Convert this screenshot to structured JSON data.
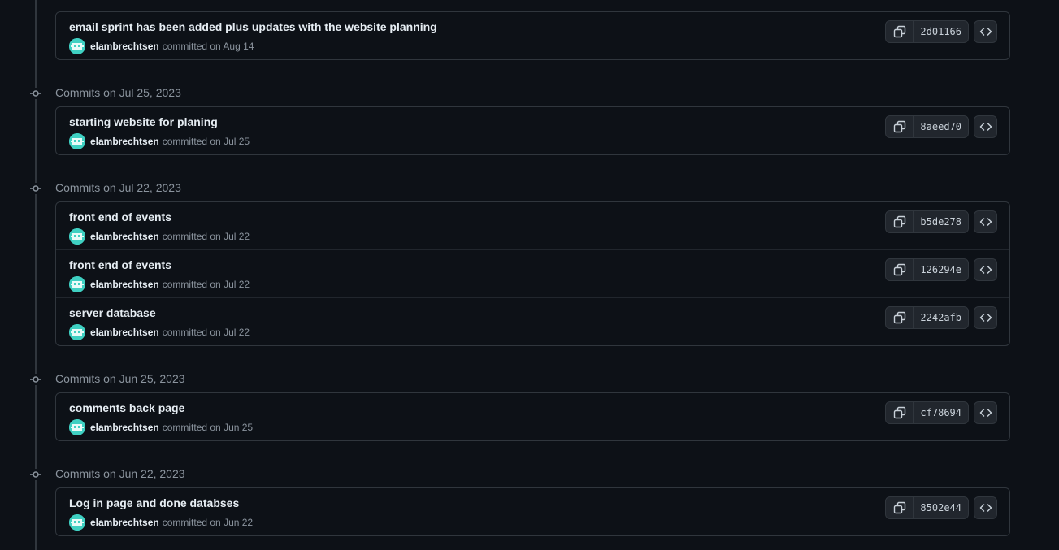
{
  "icon_names": {
    "copy": "copy-icon",
    "browse": "code-brackets-icon",
    "commit_marker": "git-commit-icon",
    "avatar": "identicon-avatar"
  },
  "colors": {
    "background": "#0d1117",
    "border": "#30363d",
    "muted_text": "#8b949e",
    "avatar": "#3fd0c2"
  },
  "groups": [
    {
      "header": "",
      "commits": [
        {
          "message": "email sprint has been added plus updates with the website planning",
          "author": "elambrechtsen",
          "committed": "committed on Aug 14",
          "sha": "2d01166"
        }
      ]
    },
    {
      "header": "Commits on Jul 25, 2023",
      "commits": [
        {
          "message": "starting website for planing",
          "author": "elambrechtsen",
          "committed": "committed on Jul 25",
          "sha": "8aeed70"
        }
      ]
    },
    {
      "header": "Commits on Jul 22, 2023",
      "commits": [
        {
          "message": "front end of events",
          "author": "elambrechtsen",
          "committed": "committed on Jul 22",
          "sha": "b5de278"
        },
        {
          "message": "front end of events",
          "author": "elambrechtsen",
          "committed": "committed on Jul 22",
          "sha": "126294e"
        },
        {
          "message": "server database",
          "author": "elambrechtsen",
          "committed": "committed on Jul 22",
          "sha": "2242afb"
        }
      ]
    },
    {
      "header": "Commits on Jun 25, 2023",
      "commits": [
        {
          "message": "comments back page",
          "author": "elambrechtsen",
          "committed": "committed on Jun 25",
          "sha": "cf78694"
        }
      ]
    },
    {
      "header": "Commits on Jun 22, 2023",
      "commits": [
        {
          "message": "Log in page and done databses",
          "author": "elambrechtsen",
          "committed": "committed on Jun 22",
          "sha": "8502e44"
        }
      ]
    }
  ]
}
